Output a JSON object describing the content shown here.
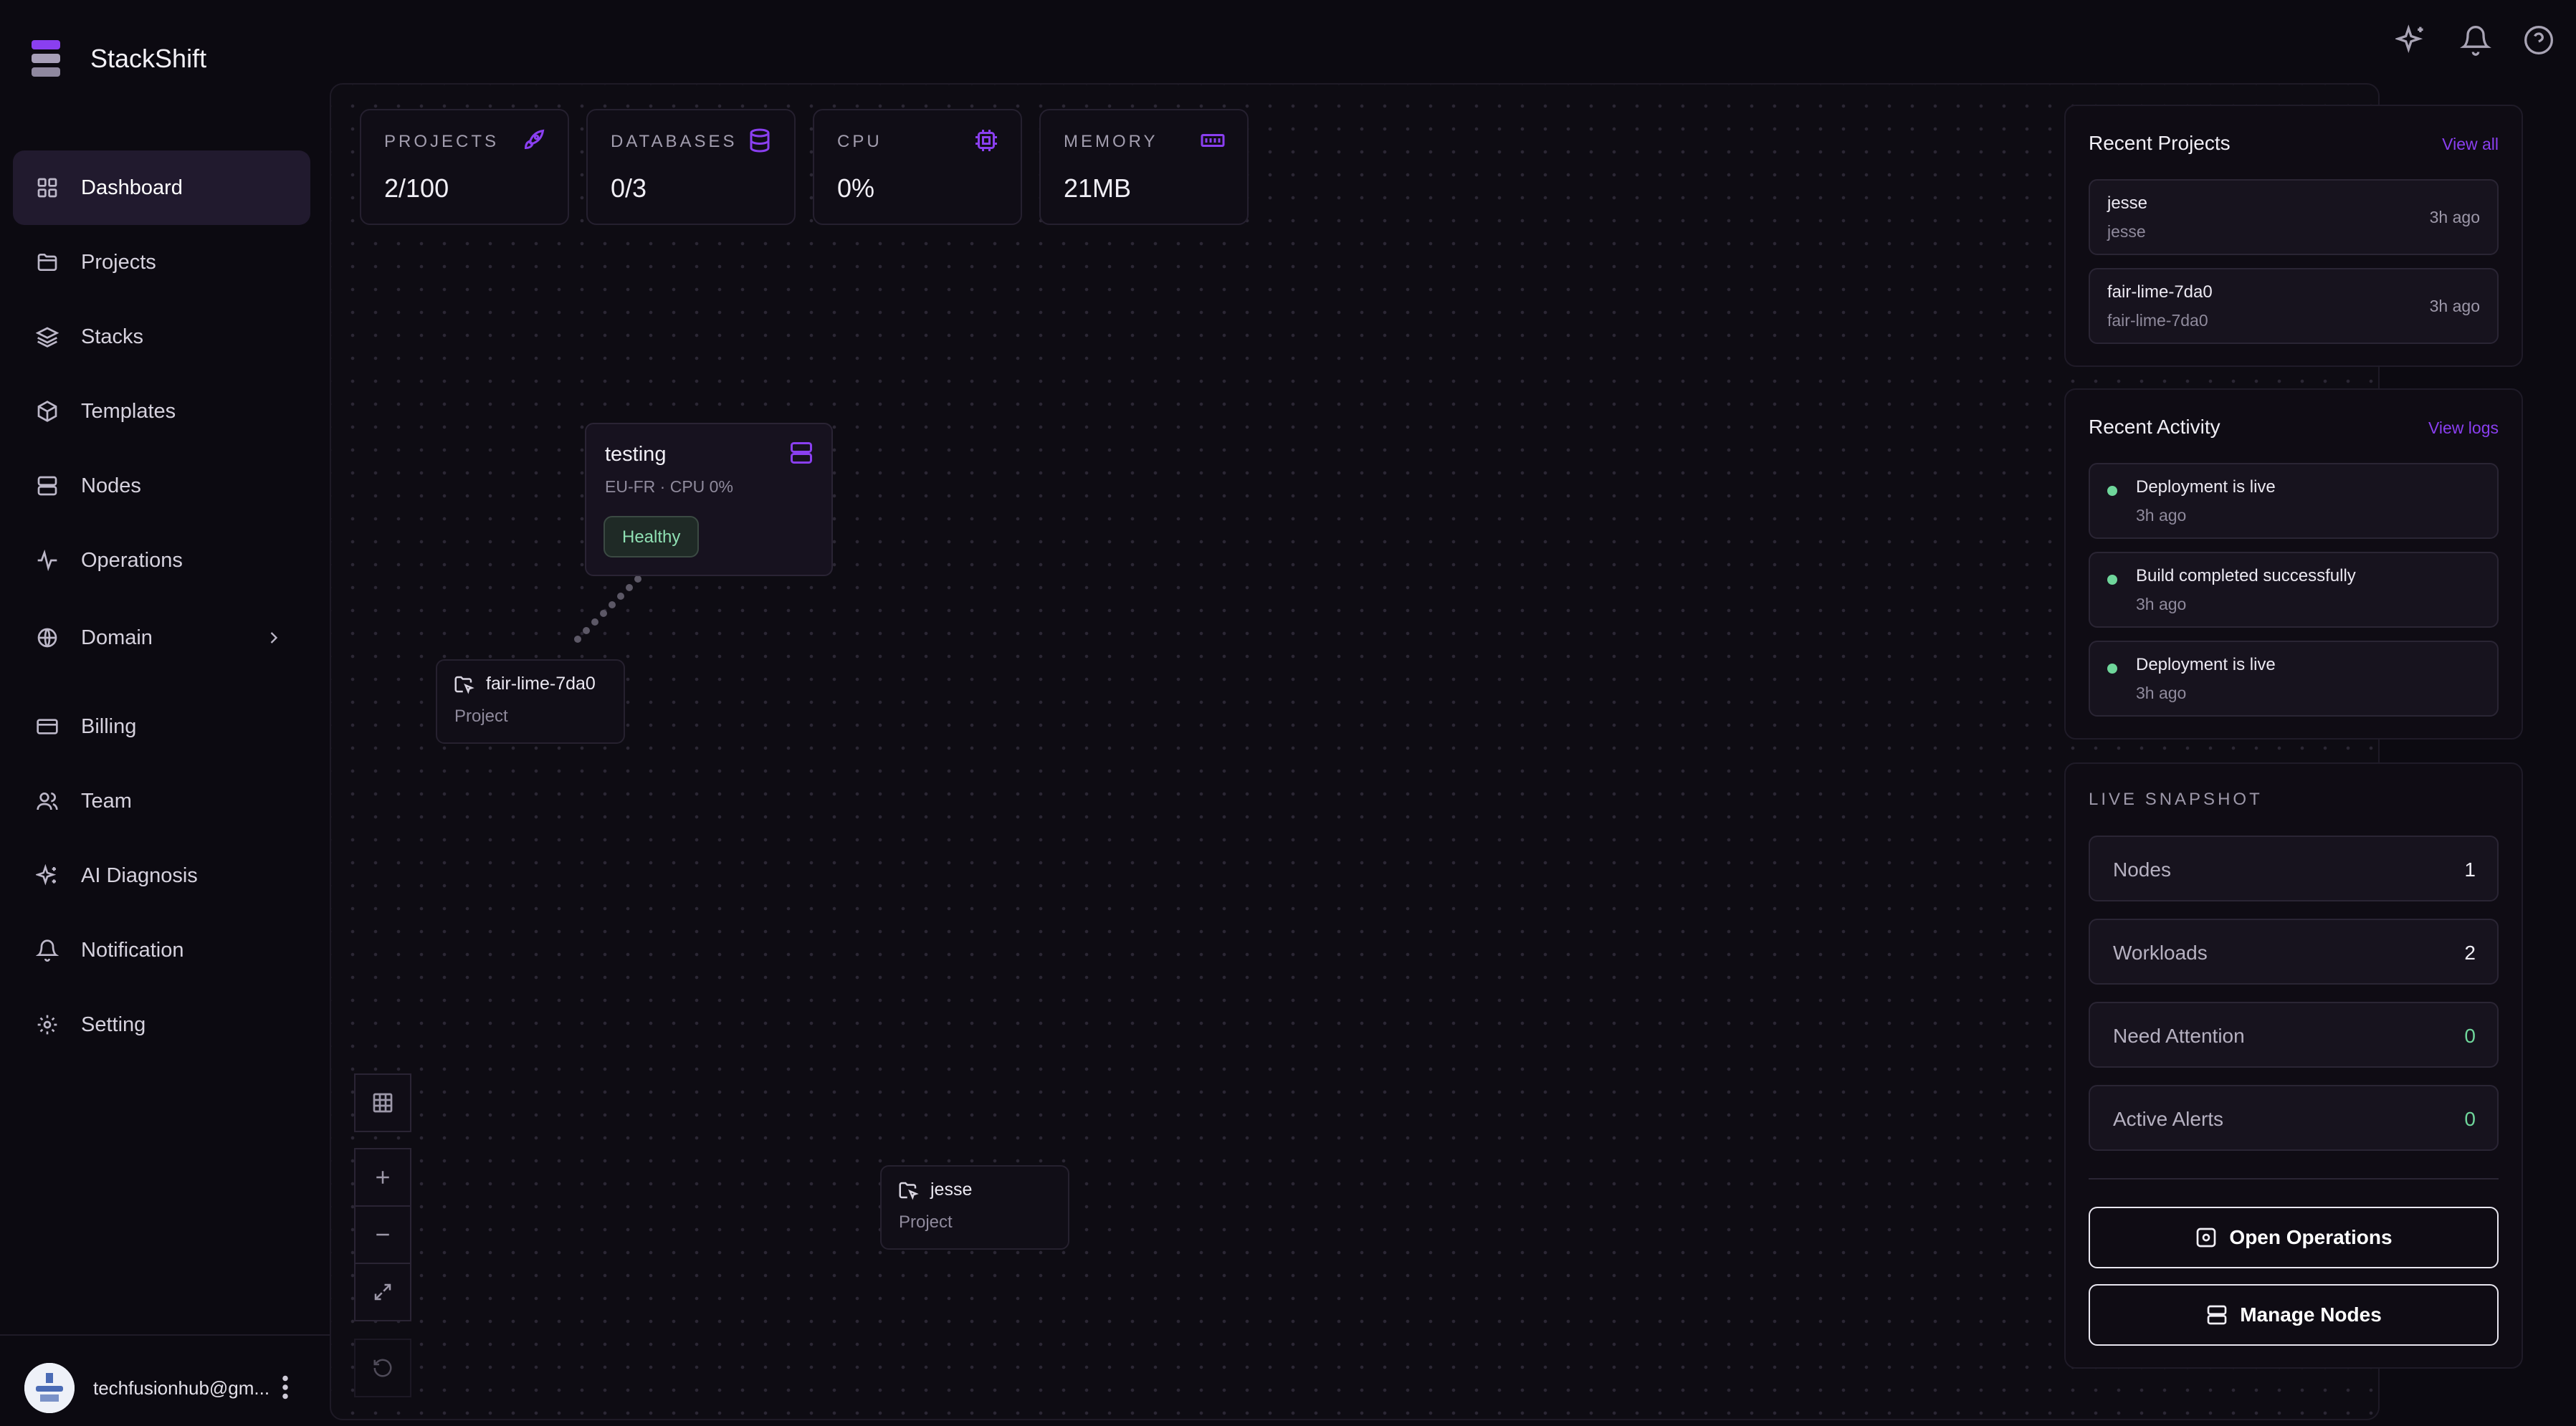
{
  "app": {
    "name": "StackShift"
  },
  "colors": {
    "accent": "#8a3ff0",
    "healthy": "#6fd69b",
    "background": "#0c0a11"
  },
  "sidebar": {
    "items": [
      {
        "label": "Dashboard",
        "icon": "grid-icon",
        "active": true
      },
      {
        "label": "Projects",
        "icon": "folder-icon"
      },
      {
        "label": "Stacks",
        "icon": "layers-icon"
      },
      {
        "label": "Templates",
        "icon": "package-icon"
      },
      {
        "label": "Nodes",
        "icon": "server-icon"
      },
      {
        "label": "Operations",
        "icon": "activity-icon"
      },
      {
        "label": "Domain",
        "icon": "globe-icon"
      },
      {
        "label": "Billing",
        "icon": "credit-card-icon"
      },
      {
        "label": "Team",
        "icon": "users-icon"
      },
      {
        "label": "AI Diagnosis",
        "icon": "sparkles-icon"
      },
      {
        "label": "Notification",
        "icon": "bell-icon"
      },
      {
        "label": "Setting",
        "icon": "gear-icon"
      }
    ],
    "user": {
      "email": "techfusionhub@gm..."
    }
  },
  "stats": [
    {
      "label": "PROJECTS",
      "value": "2/100",
      "icon": "rocket-icon"
    },
    {
      "label": "DATABASES",
      "value": "0/3",
      "icon": "database-icon"
    },
    {
      "label": "CPU",
      "value": "0%",
      "icon": "cpu-icon"
    },
    {
      "label": "MEMORY",
      "value": "21MB",
      "icon": "memory-icon"
    }
  ],
  "canvas": {
    "server_node": {
      "title": "testing",
      "subtitle": "EU-FR · CPU 0%",
      "status": "Healthy"
    },
    "project_nodes": [
      {
        "title": "fair-lime-7da0",
        "subtitle": "Project"
      },
      {
        "title": "jesse",
        "subtitle": "Project"
      }
    ]
  },
  "recent_projects": {
    "title": "Recent Projects",
    "link": "View all",
    "items": [
      {
        "name": "jesse",
        "sub": "jesse",
        "time": "3h ago"
      },
      {
        "name": "fair-lime-7da0",
        "sub": "fair-lime-7da0",
        "time": "3h ago"
      }
    ]
  },
  "recent_activity": {
    "title": "Recent Activity",
    "link": "View logs",
    "items": [
      {
        "text": "Deployment is live",
        "time": "3h ago"
      },
      {
        "text": "Build completed successfully",
        "time": "3h ago"
      },
      {
        "text": "Deployment is live",
        "time": "3h ago"
      }
    ]
  },
  "live_snapshot": {
    "title": "LIVE SNAPSHOT",
    "rows": [
      {
        "name": "Nodes",
        "value": "1"
      },
      {
        "name": "Workloads",
        "value": "2"
      },
      {
        "name": "Need Attention",
        "value": "0"
      },
      {
        "name": "Active Alerts",
        "value": "0"
      }
    ],
    "buttons": {
      "operations": "Open Operations",
      "nodes": "Manage Nodes"
    }
  }
}
